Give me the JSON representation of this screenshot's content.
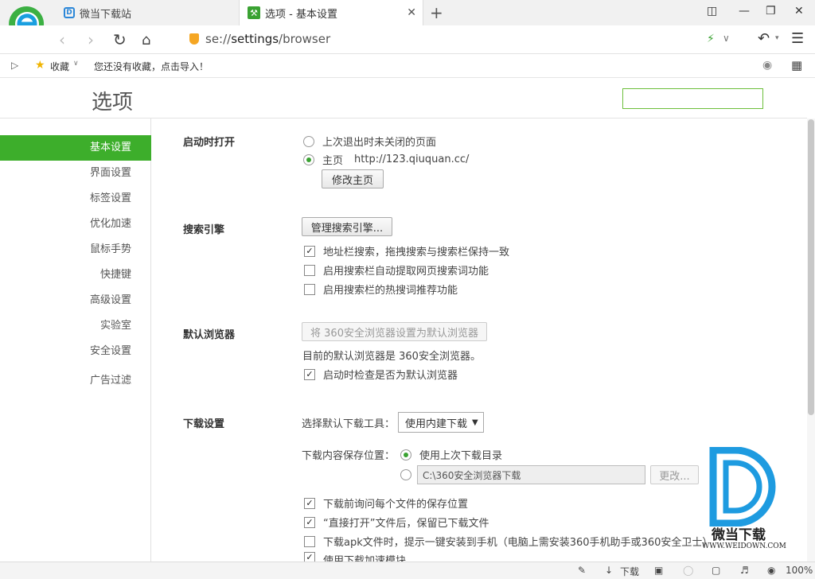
{
  "tabs": [
    {
      "title": "微当下载站"
    },
    {
      "title": "选项 - 基本设置"
    }
  ],
  "address": {
    "prefix": "se://",
    "bold": "settings",
    "suffix": "/browser"
  },
  "bookmarks": {
    "favorites_label": "收藏",
    "hint": "您还没有收藏，点击导入！"
  },
  "page": {
    "title": "选项"
  },
  "sidebar": {
    "items": [
      {
        "label": "基本设置"
      },
      {
        "label": "界面设置"
      },
      {
        "label": "标签设置"
      },
      {
        "label": "优化加速"
      },
      {
        "label": "鼠标手势"
      },
      {
        "label": "快捷键"
      },
      {
        "label": "高级设置"
      },
      {
        "label": "实验室"
      },
      {
        "label": "安全设置"
      },
      {
        "label": "广告过滤"
      }
    ]
  },
  "startup": {
    "title": "启动时打开",
    "opt_last": "上次退出时未关闭的页面",
    "opt_home": "主页",
    "home_url": "http://123.qiuquan.cc/",
    "edit_home_btn": "修改主页"
  },
  "search": {
    "title": "搜索引擎",
    "manage_btn": "管理搜索引擎...",
    "cb1": "地址栏搜索，拖拽搜索与搜索栏保持一致",
    "cb2": "启用搜索栏自动提取网页搜索词功能",
    "cb3": "启用搜索栏的热搜词推荐功能"
  },
  "default_browser": {
    "title": "默认浏览器",
    "set_btn": "将 360安全浏览器设置为默认浏览器",
    "status": "目前的默认浏览器是 360安全浏览器。",
    "cb": "启动时检查是否为默认浏览器"
  },
  "download": {
    "title": "下载设置",
    "tool_label": "选择默认下载工具：",
    "tool_value": "使用内建下载",
    "save_label": "下载内容保存位置：",
    "opt_last_dir": "使用上次下载目录",
    "path": "C:\\360安全浏览器下载",
    "change_btn": "更改...",
    "cb1": "下载前询问每个文件的保存位置",
    "cb2": "“直接打开”文件后，保留已下载文件",
    "cb3": "下载apk文件时，提示一键安装到手机（电脑上需安装360手机助手或360安全卫士）",
    "cb4": "使用下载加速模块"
  },
  "status": {
    "download": "下载",
    "zoom": "100%"
  },
  "watermark": {
    "brand": "微当下载",
    "url": "WWW.WEIDOWN.COM"
  },
  "colors": {
    "accent": "#3dae2b",
    "watermark_blue": "#1e9be0"
  }
}
